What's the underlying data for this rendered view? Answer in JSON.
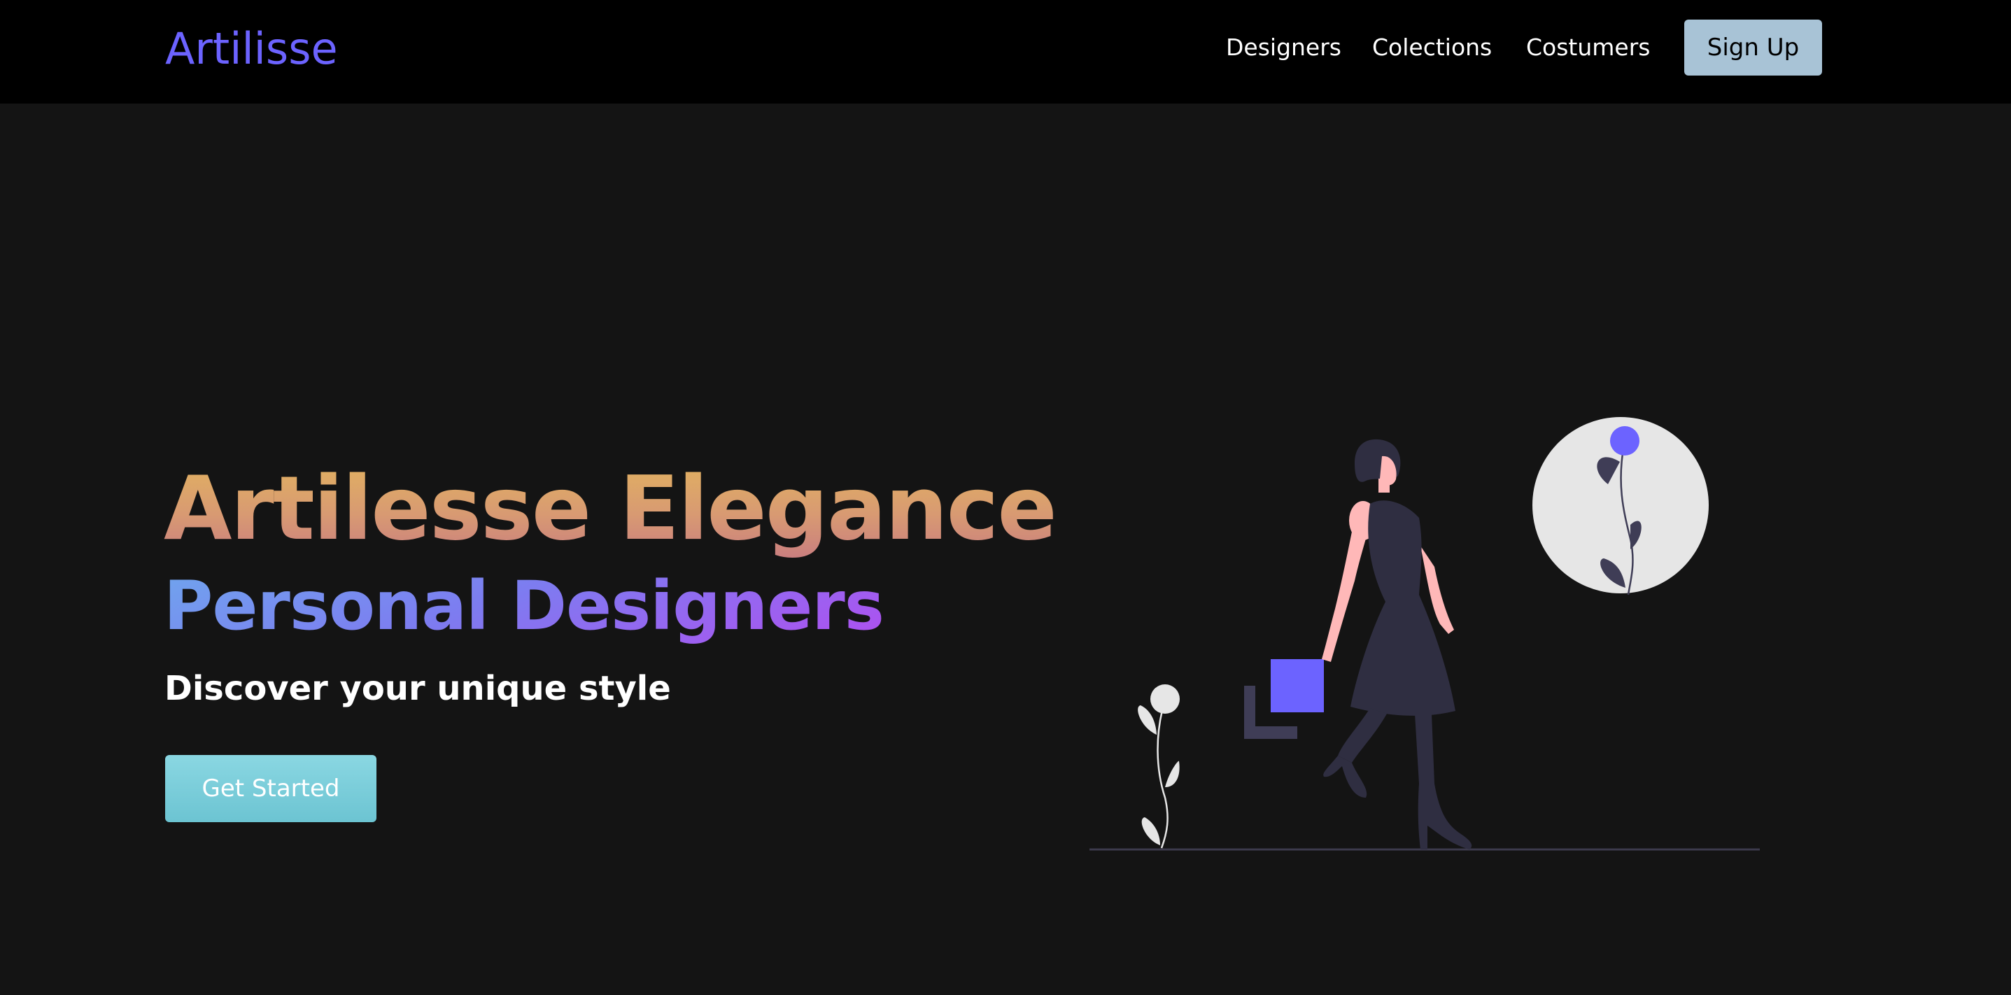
{
  "header": {
    "logo": "Artilisse",
    "nav": [
      "Designers",
      "Colections",
      "Costumers"
    ],
    "signup_label": "Sign Up"
  },
  "hero": {
    "title": "Artilesse Elegance",
    "subtitle": "Personal Designers",
    "tagline": "Discover your unique style",
    "cta_label": "Get Started"
  },
  "colors": {
    "background": "#141414",
    "navbar": "#000000",
    "logo": "#6c63ff",
    "accent_purple": "#6c63ff",
    "signup_bg": "#a8c3d6",
    "cta_bg": "#7ccfdc",
    "title_gradient": [
      "#e2b35f",
      "#c97d80"
    ],
    "subtitle_gradient": [
      "#6fa6ee",
      "#b14ef0"
    ]
  },
  "illustration": {
    "icon": "woman-walking-with-shopping-bag-illustration"
  }
}
